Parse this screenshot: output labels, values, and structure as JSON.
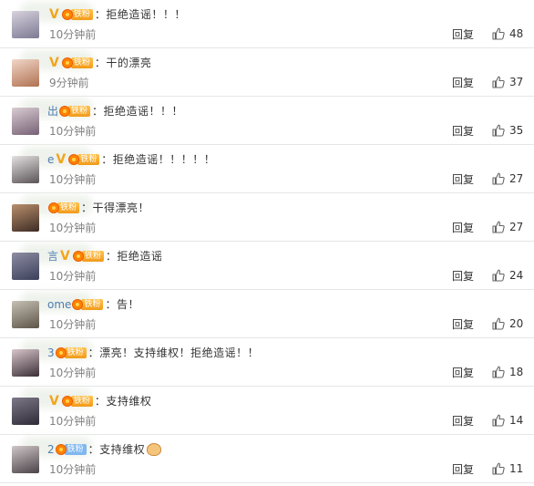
{
  "colors": {
    "nickname": "#507daf",
    "verified": "#f2a51c",
    "fan_badge": "#f29a1a",
    "fan_badge_blue": "#7fb7f0",
    "timestamp": "#808080",
    "divider": "#e6e6e6"
  },
  "comments": [
    {
      "nick": "",
      "verified": "V",
      "badge": "铁粉",
      "text": "：拒绝造谣！！！",
      "time": "10分钟前",
      "reply": "回复",
      "likes": "48",
      "avatar": [
        "#d8d2dd",
        "#7c7a93"
      ]
    },
    {
      "nick": "",
      "verified": "V",
      "badge": "铁粉",
      "text": "：干的漂亮",
      "time": "9分钟前",
      "reply": "回复",
      "likes": "37",
      "avatar": [
        "#f1d6c8",
        "#b07252"
      ]
    },
    {
      "nick": "出",
      "verified": "",
      "badge": "铁粉",
      "text": "：拒绝造谣！！！",
      "time": "10分钟前",
      "reply": "回复",
      "likes": "35",
      "avatar": [
        "#d9ccd2",
        "#766175"
      ]
    },
    {
      "nick": "e",
      "verified": "V",
      "badge": "铁粉",
      "text": "：拒绝造谣！！！！！",
      "time": "10分钟前",
      "reply": "回复",
      "likes": "27",
      "avatar": [
        "#e4e0e0",
        "#5a5456"
      ]
    },
    {
      "nick": "",
      "verified": "",
      "badge": "铁粉",
      "text": "：干得漂亮！",
      "time": "10分钟前",
      "reply": "回复",
      "likes": "27",
      "avatar": [
        "#b98f6d",
        "#3d2c24"
      ]
    },
    {
      "nick": "言",
      "verified": "V",
      "badge": "铁粉",
      "text": "：拒绝造谣",
      "time": "10分钟前",
      "reply": "回复",
      "likes": "24",
      "avatar": [
        "#8c8da2",
        "#3c3f5a"
      ]
    },
    {
      "nick": "ome",
      "verified": "",
      "badge": "铁粉",
      "text": "：告！",
      "time": "10分钟前",
      "reply": "回复",
      "likes": "20",
      "avatar": [
        "#c6c0b5",
        "#5d5547"
      ]
    },
    {
      "nick": "3",
      "verified": "",
      "badge": "铁粉",
      "text": "：漂亮！支持维权！拒绝造谣！！",
      "time": "10分钟前",
      "reply": "回复",
      "likes": "18",
      "avatar": [
        "#d7c5cb",
        "#3a2f35"
      ]
    },
    {
      "nick": "",
      "verified": "V",
      "badge": "铁粉",
      "text": "：支持维权",
      "time": "10分钟前",
      "reply": "回复",
      "likes": "14",
      "avatar": [
        "#7d7888",
        "#2e2b36"
      ]
    },
    {
      "nick": "2",
      "verified": "",
      "badge": "铁粉",
      "badge_style": "blue",
      "text": "：支持维权",
      "emoji": "cat-emoji",
      "time": "10分钟前",
      "reply": "回复",
      "likes": "11",
      "avatar": [
        "#cfc6c8",
        "#4b4248"
      ]
    }
  ]
}
